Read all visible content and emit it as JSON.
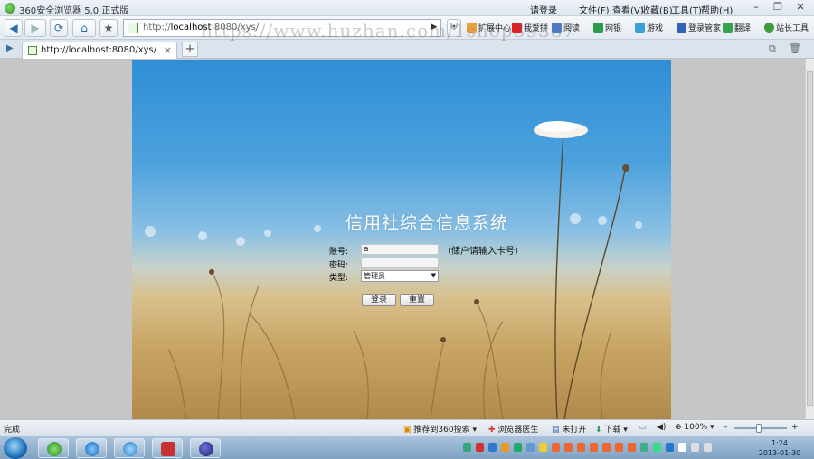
{
  "browser": {
    "title": "360安全浏览器 5.0 正式版",
    "menus": [
      "请登录",
      "文件(F)",
      "查看(V)",
      "收藏(B)",
      "工具(T)",
      "帮助(H)"
    ],
    "address": {
      "url_prefix": "http://",
      "url_host": "localhost",
      "url_rest": ":8080/xys/"
    },
    "toolbar": [
      "扩展中心",
      "我爱拼",
      "阅读",
      "网银",
      "游戏",
      "登录管家",
      "翻译",
      "站长工具"
    ],
    "tab": {
      "title": "http://localhost:8080/xys/"
    }
  },
  "page": {
    "title": "信用社综合信息系统",
    "form": {
      "account_label": "账号:",
      "account_value": "a",
      "account_hint": "（储户请输入卡号）",
      "password_label": "密码:",
      "type_label": "类型:",
      "type_selected": "管理员",
      "login_button": "登录",
      "reset_button": "重置"
    }
  },
  "status": {
    "left": "完成",
    "items": [
      "推荐到360搜索",
      "浏览器医生",
      "未打开",
      "下载"
    ],
    "zoom": "100%"
  },
  "taskbar": {
    "time": "1:24",
    "date": "2013-01-30"
  },
  "watermark": "https://www.huzhan.com/1shop39387"
}
